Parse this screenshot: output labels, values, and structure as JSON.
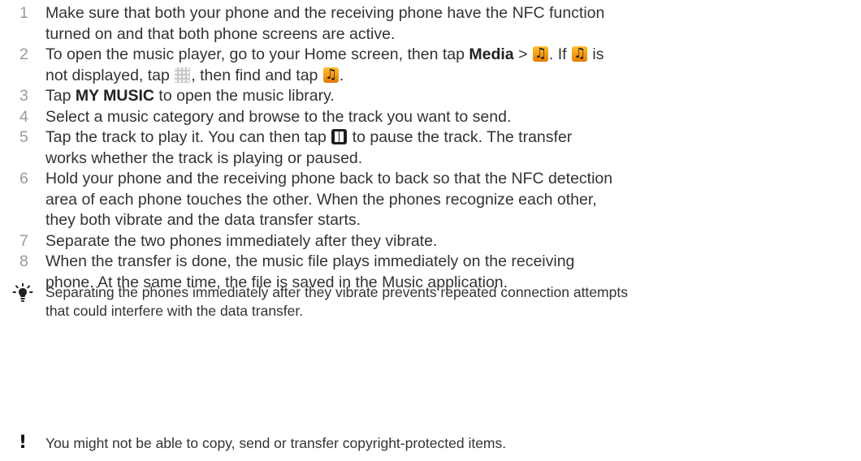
{
  "steps": [
    {
      "num": "1",
      "lines": [
        "Make sure that both your phone and the receiving phone have the NFC function",
        "turned on and that both phone screens are active."
      ]
    },
    {
      "num": "2",
      "parts": [
        "To open the music player, go to your Home screen, then tap ",
        "Media",
        " > ",
        ". If ",
        " is",
        "not displayed, tap ",
        ", then find and tap ",
        "."
      ]
    },
    {
      "num": "3",
      "parts": [
        "Tap ",
        "MY MUSIC",
        " to open the music library."
      ]
    },
    {
      "num": "4",
      "lines": [
        "Select a music category and browse to the track you want to send."
      ]
    },
    {
      "num": "5",
      "parts": [
        "Tap the track to play it. You can then tap ",
        " to pause the track. The transfer",
        "works whether the track is playing or paused."
      ]
    },
    {
      "num": "6",
      "lines": [
        "Hold your phone and the receiving phone back to back so that the NFC detection",
        "area of each phone touches the other. When the phones recognize each other,",
        "they both vibrate and the data transfer starts."
      ]
    },
    {
      "num": "7",
      "lines": [
        "Separate the two phones immediately after they vibrate."
      ]
    },
    {
      "num": "8",
      "lines": [
        "When the transfer is done, the music file plays immediately on the receiving",
        "phone. At the same time, the file is saved in the Music application."
      ]
    }
  ],
  "tip": {
    "icon": "lightbulb-icon",
    "lines": [
      "Separating the phones immediately after they vibrate prevents repeated connection attempts",
      "that could interfere with the data transfer."
    ]
  },
  "warning": {
    "icon": "exclamation-icon",
    "text": "You might not be able to copy, send or transfer copyright-protected items."
  },
  "icons": {
    "music_player": "music-player-icon",
    "app_grid": "application-grid-icon",
    "pause": "pause-icon"
  },
  "colors": {
    "step_number": "#9a9a9a",
    "text": "#333333",
    "music_icon": "#f39c12"
  }
}
